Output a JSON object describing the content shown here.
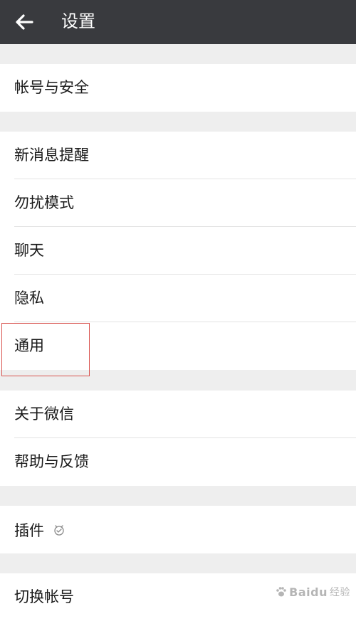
{
  "header": {
    "title": "设置",
    "back_icon": "arrow-left-icon"
  },
  "groups": [
    {
      "items": [
        {
          "label": "帐号与安全"
        }
      ]
    },
    {
      "items": [
        {
          "label": "新消息提醒"
        },
        {
          "label": "勿扰模式"
        },
        {
          "label": "聊天"
        },
        {
          "label": "隐私"
        },
        {
          "label": "通用"
        }
      ]
    },
    {
      "items": [
        {
          "label": "关于微信"
        },
        {
          "label": "帮助与反馈"
        }
      ]
    },
    {
      "items": [
        {
          "label": "插件",
          "icon": "plugin-status-icon"
        }
      ]
    },
    {
      "items": [
        {
          "label": "切换帐号"
        }
      ]
    }
  ],
  "highlight": {
    "target": "通用",
    "color": "#d9534f"
  },
  "watermark": {
    "brand": "Baidu",
    "suffix": "经验"
  },
  "colors": {
    "header_bg": "#393a3e",
    "page_bg": "#eeeeee",
    "item_bg": "#ffffff",
    "text": "#1a1a1a"
  }
}
